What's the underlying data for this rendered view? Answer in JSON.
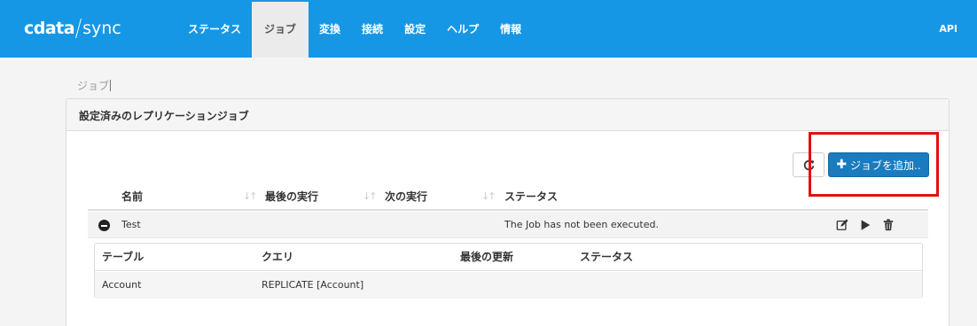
{
  "brand": {
    "name_part1": "cdata",
    "name_part2": "sync"
  },
  "nav": {
    "items": [
      {
        "label": "ステータス",
        "active": false
      },
      {
        "label": "ジョブ",
        "active": true
      },
      {
        "label": "変換",
        "active": false
      },
      {
        "label": "接続",
        "active": false
      },
      {
        "label": "設定",
        "active": false
      },
      {
        "label": "ヘルプ",
        "active": false
      },
      {
        "label": "情報",
        "active": false
      }
    ],
    "api_label": "API"
  },
  "breadcrumb": "ジョブ",
  "panel": {
    "title": "設定済みのレプリケーションジョブ",
    "add_job_label": "ジョブを追加..",
    "refresh_icon": "refresh-icon"
  },
  "jobs_table": {
    "headers": [
      "名前",
      "最後の実行",
      "次の実行",
      "ステータス"
    ],
    "rows": [
      {
        "name": "Test",
        "last_run": "",
        "next_run": "",
        "status": "The Job has not been executed."
      }
    ]
  },
  "queries_table": {
    "headers": [
      "テーブル",
      "クエリ",
      "最後の更新",
      "ステータス"
    ],
    "rows": [
      {
        "table": "Account",
        "query": "REPLICATE [Account]",
        "last_update": "",
        "status": ""
      }
    ]
  },
  "colors": {
    "topbar": "#1597e5",
    "primary_button": "#1a7bbf",
    "highlight_box": "#e30e0e"
  }
}
